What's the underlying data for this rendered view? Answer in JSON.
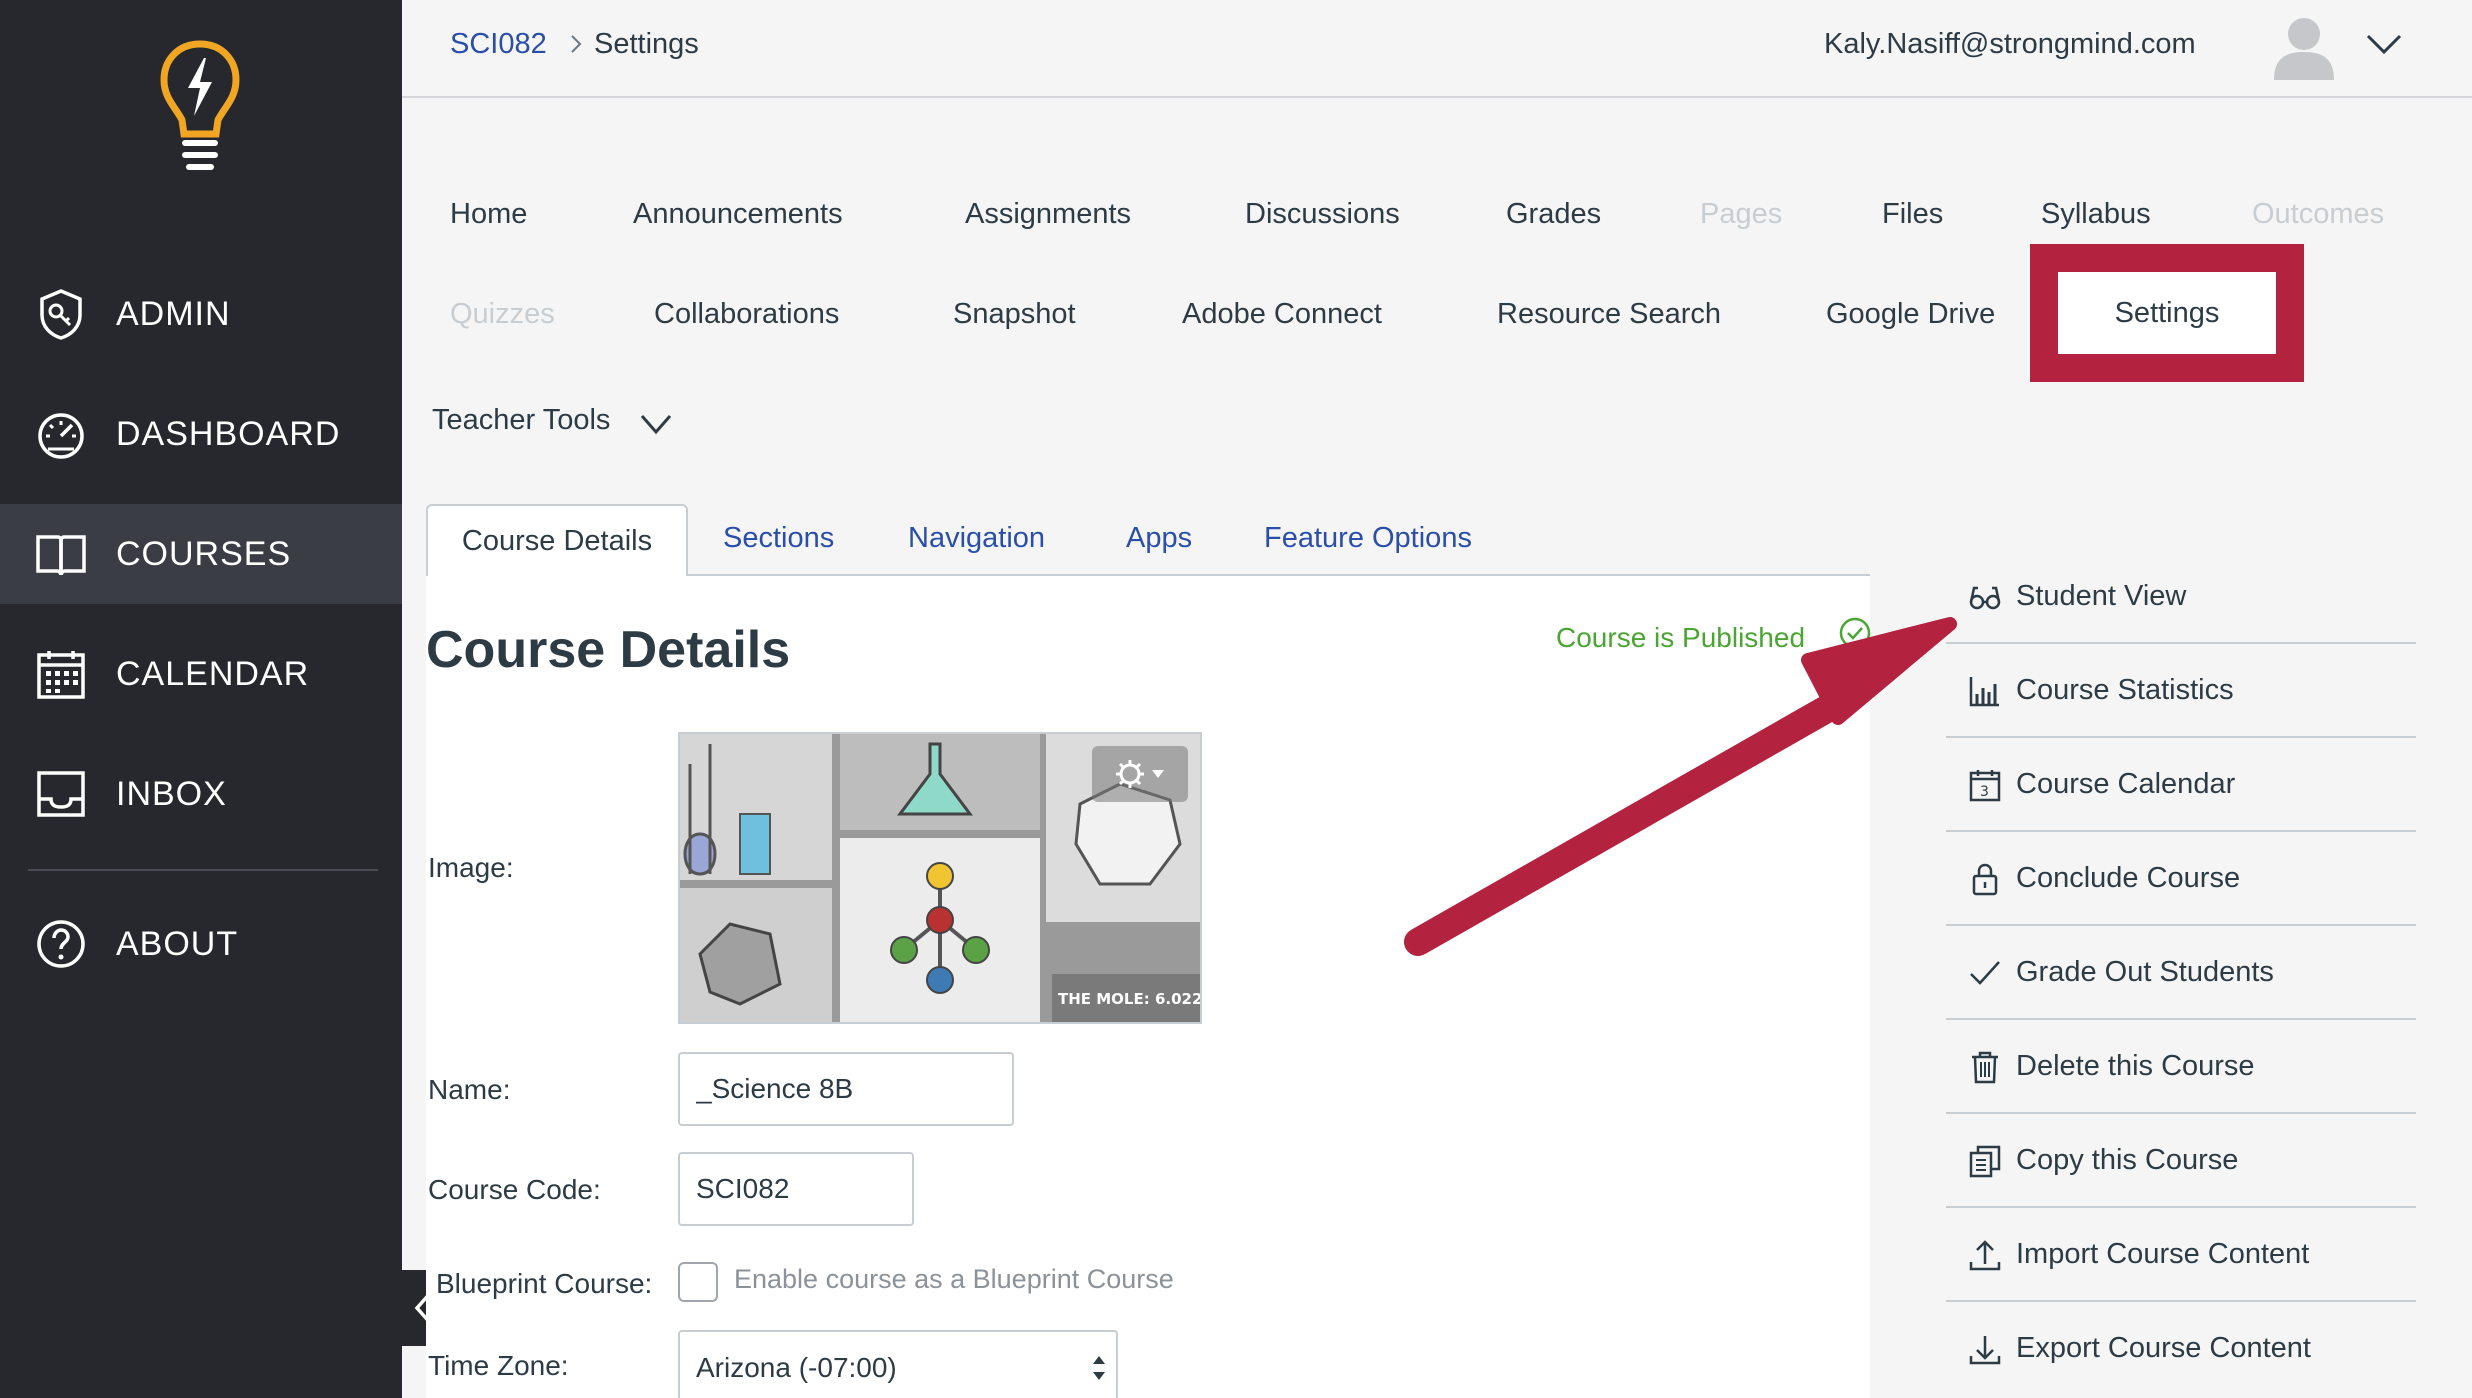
{
  "sidebar": {
    "items": [
      {
        "label": "ADMIN",
        "icon": "shield-key-icon"
      },
      {
        "label": "DASHBOARD",
        "icon": "speedometer-icon"
      },
      {
        "label": "COURSES",
        "icon": "open-book-icon"
      },
      {
        "label": "CALENDAR",
        "icon": "calendar-icon"
      },
      {
        "label": "INBOX",
        "icon": "inbox-tray-icon"
      },
      {
        "label": "ABOUT",
        "icon": "question-circle-icon"
      }
    ],
    "active": "COURSES"
  },
  "header": {
    "breadcrumb_course": "SCI082",
    "breadcrumb_current": "Settings",
    "user_email": "Kaly.Nasiff@strongmind.com"
  },
  "course_nav": {
    "row1": [
      "Home",
      "Announcements",
      "Assignments",
      "Discussions",
      "Grades",
      "Pages",
      "Files",
      "Syllabus",
      "Outcomes"
    ],
    "row2": [
      "Quizzes",
      "Collaborations",
      "Snapshot",
      "Adobe Connect",
      "Resource Search",
      "Google Drive",
      "Settings"
    ],
    "disabled": [
      "Pages",
      "Outcomes",
      "Quizzes"
    ],
    "teacher_tools": "Teacher Tools"
  },
  "tabs": [
    "Course Details",
    "Sections",
    "Navigation",
    "Apps",
    "Feature Options"
  ],
  "details": {
    "title": "Course Details",
    "status": "Course is Published",
    "image_label": "Image:",
    "image_caption": "THE MOLE: 6.022",
    "name_label": "Name:",
    "name_value": "_Science 8B",
    "code_label": "Course Code:",
    "code_value": "SCI082",
    "blueprint_label": "Blueprint Course:",
    "blueprint_checkbox": "Enable course as a Blueprint Course",
    "timezone_label": "Time Zone:",
    "timezone_value": "Arizona (-07:00)"
  },
  "actions": [
    {
      "label": "Student View",
      "icon": "glasses-icon"
    },
    {
      "label": "Course Statistics",
      "icon": "bar-chart-icon"
    },
    {
      "label": "Course Calendar",
      "icon": "calendar-day-icon"
    },
    {
      "label": "Conclude Course",
      "icon": "lock-icon"
    },
    {
      "label": "Grade Out Students",
      "icon": "checkmark-icon"
    },
    {
      "label": "Delete this Course",
      "icon": "trash-icon"
    },
    {
      "label": "Copy this Course",
      "icon": "copy-icon"
    },
    {
      "label": "Import Course Content",
      "icon": "upload-icon"
    },
    {
      "label": "Export Course Content",
      "icon": "download-icon"
    }
  ],
  "colors": {
    "sidebar_bg": "#26282d",
    "highlight": "#b3233f",
    "link": "#2b4fa8",
    "published": "#4aa533",
    "logo": "#f0a623"
  }
}
